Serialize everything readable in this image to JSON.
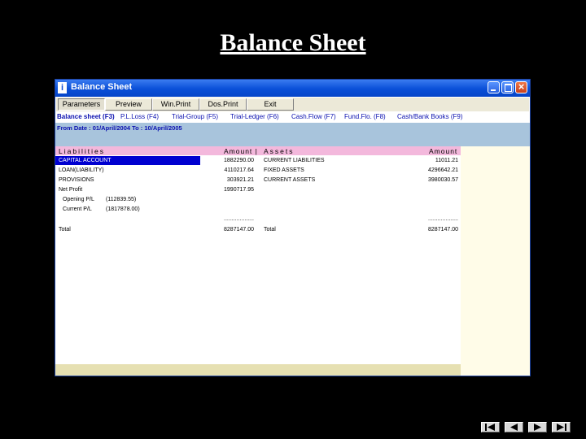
{
  "slide": {
    "title": "Balance Sheet"
  },
  "window": {
    "title": "Balance Sheet",
    "icon_letter": "i"
  },
  "toolbar": {
    "buttons": [
      "Parameters",
      "Preview",
      "Win.Print",
      "Dos.Print",
      "Exit"
    ],
    "pressed_index": 0
  },
  "report_keys": [
    "Balance sheet (F3)",
    "P.L.Loss (F4)",
    "Trial-Group (F5)",
    "Trial-Ledger (F6)",
    "Cash.Flow (F7)",
    "Fund.Flo. (F8)",
    "Cash/Bank Books (F9)"
  ],
  "date_range": "From Date : 01/April/2004 To : 10/April/2005",
  "headers": {
    "liabilities": "Liabilities",
    "amount_left": "Amount |",
    "assets": "Assets",
    "amount_right": "Amount"
  },
  "liabilities": [
    {
      "label": "CAPITAL ACCOUNT",
      "amount": "1882290.00",
      "selected": true
    },
    {
      "label": "LOAN(LIABILITY)",
      "amount": "4110217.64"
    },
    {
      "label": "PROVISIONS",
      "amount": "303921.21"
    },
    {
      "label": "Net Profit",
      "amount": "1990717.95"
    }
  ],
  "profit_detail": [
    {
      "label": "Opening P/L",
      "value": "(112839.55)"
    },
    {
      "label": "Current P/L",
      "value": "(1817878.00)"
    }
  ],
  "assets": [
    {
      "label": "CURRENT LIABILITIES",
      "amount": "11011.21"
    },
    {
      "label": "FIXED ASSETS",
      "amount": "4296642.21"
    },
    {
      "label": "CURRENT ASSETS",
      "amount": "3980030.57"
    }
  ],
  "separator": "...................",
  "totals": {
    "left_label": "Total",
    "left_amount": "8287147.00",
    "right_label": "Total",
    "right_amount": "8287147.00"
  }
}
